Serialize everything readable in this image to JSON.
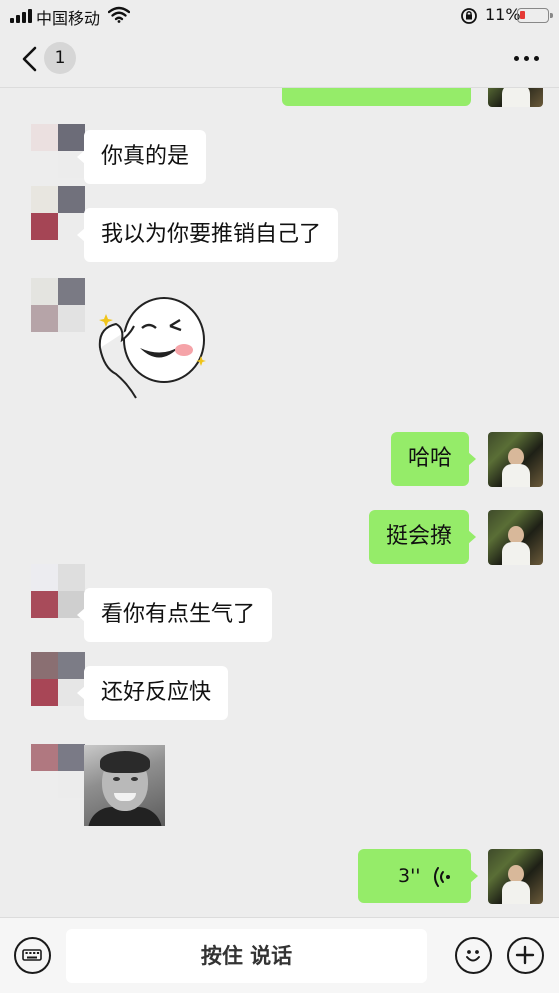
{
  "status_bar": {
    "carrier": "中国移动",
    "battery_percent": "11%",
    "battery_level": 0.11,
    "battery_color": "#e53935"
  },
  "nav": {
    "back_icon": "chevron-left-icon",
    "unread_count": "1",
    "more_icon": "more-dots-icon"
  },
  "messages": [
    {
      "side": "right",
      "type": "text",
      "text": "",
      "partial": true
    },
    {
      "side": "left",
      "type": "text",
      "text": "你真的是"
    },
    {
      "side": "left",
      "type": "text",
      "text": "我以为你要推销自己了"
    },
    {
      "side": "left",
      "type": "sticker",
      "icon": "winking-face-sticker"
    },
    {
      "side": "right",
      "type": "text",
      "text": "哈哈"
    },
    {
      "side": "right",
      "type": "text",
      "text": "挺会撩"
    },
    {
      "side": "left",
      "type": "text",
      "text": "看你有点生气了"
    },
    {
      "side": "left",
      "type": "text",
      "text": "还好反应快"
    },
    {
      "side": "left",
      "type": "image",
      "icon": "portrait-photo"
    },
    {
      "side": "right",
      "type": "voice",
      "duration": "3''"
    }
  ],
  "input_bar": {
    "keyboard_icon": "keyboard-icon",
    "hold_to_talk_label": "按住 说话",
    "emoji_icon": "emoji-icon",
    "plus_icon": "plus-icon"
  },
  "colors": {
    "background": "#ededed",
    "bubble_self": "#95ec69",
    "bubble_other": "#ffffff",
    "input_bar": "#f6f6f6"
  }
}
